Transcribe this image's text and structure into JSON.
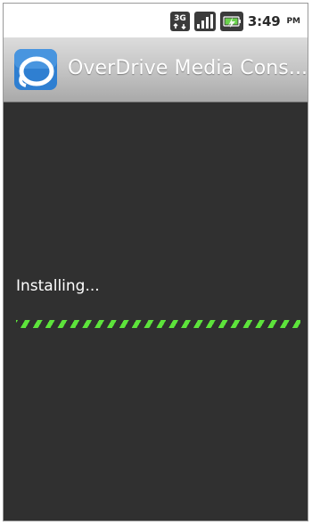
{
  "status_bar": {
    "network_label": "3G",
    "time": "3:49",
    "ampm": "PM"
  },
  "app_bar": {
    "title": "OverDrive Media Cons..."
  },
  "installer": {
    "label": "Installing...",
    "progress_style": "indeterminate",
    "progress_color": "#5de33b"
  },
  "colors": {
    "background": "#303030",
    "title_text": "#ffffff",
    "accent_icon": "#2f7fd1"
  },
  "icons": [
    "network-3g-icon",
    "signal-strength-icon",
    "battery-icon",
    "overdrive-app-icon"
  ]
}
